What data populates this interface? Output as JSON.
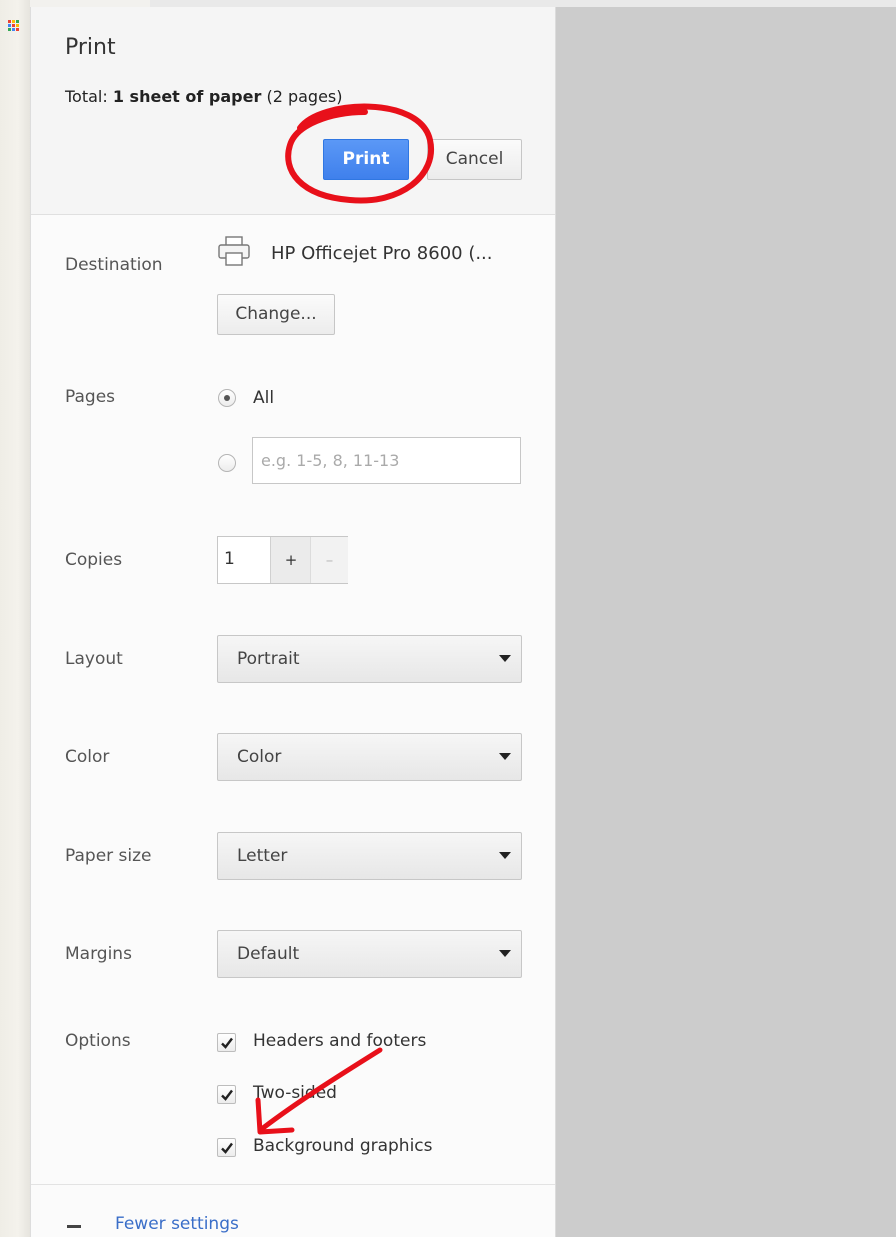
{
  "dialog": {
    "title": "Print",
    "summary_prefix": "Total: ",
    "summary_bold": "1 sheet of paper",
    "summary_suffix": " (2 pages)",
    "print_label": "Print",
    "cancel_label": "Cancel"
  },
  "destination": {
    "label": "Destination",
    "printer_name": "HP Officejet Pro 8600 (...",
    "change_label": "Change..."
  },
  "pages": {
    "label": "Pages",
    "all_label": "All",
    "all_selected": true,
    "custom_placeholder": "e.g. 1-5, 8, 11-13"
  },
  "copies": {
    "label": "Copies",
    "value": "1",
    "plus": "+",
    "minus": "–"
  },
  "layout": {
    "label": "Layout",
    "value": "Portrait"
  },
  "color": {
    "label": "Color",
    "value": "Color"
  },
  "paper_size": {
    "label": "Paper size",
    "value": "Letter"
  },
  "margins": {
    "label": "Margins",
    "value": "Default"
  },
  "options": {
    "label": "Options",
    "items": [
      {
        "label": "Headers and footers",
        "checked": true
      },
      {
        "label": "Two-sided",
        "checked": true
      },
      {
        "label": "Background graphics",
        "checked": true
      }
    ]
  },
  "footer": {
    "fewer_settings": "Fewer settings"
  },
  "colors": {
    "primary_button": "#4285f4",
    "link": "#3a6ec8",
    "preview_bg": "#cccccc",
    "annotation": "#e8101a"
  }
}
